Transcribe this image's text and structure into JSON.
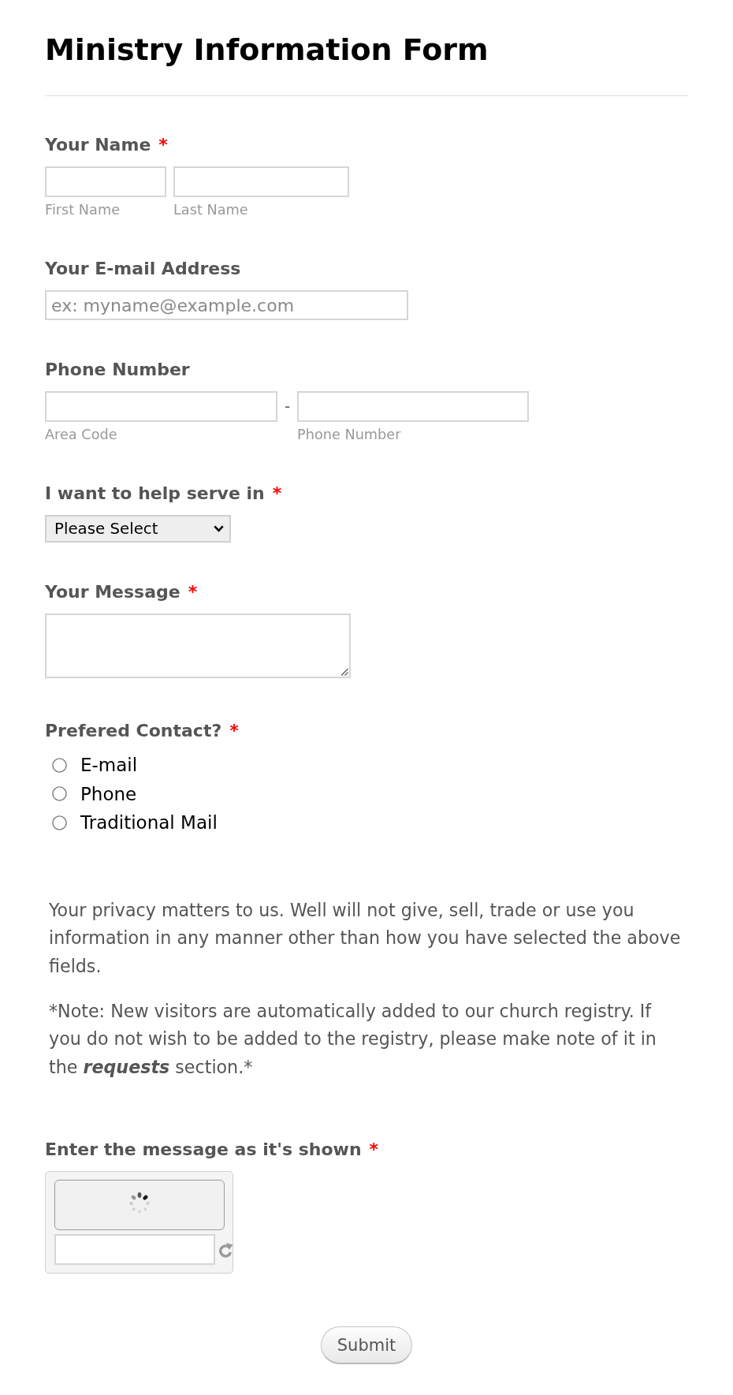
{
  "title": "Ministry Information Form",
  "fields": [
    {
      "kind": "name",
      "label": "Your Name",
      "required_mark": "*",
      "inputs": [
        {
          "sublabel": "First Name"
        },
        {
          "sublabel": "Last Name"
        }
      ]
    },
    {
      "kind": "email",
      "label": "Your E-mail Address",
      "placeholder": "ex: myname@example.com"
    },
    {
      "kind": "phone",
      "label": "Phone Number",
      "separator": "-",
      "inputs": [
        {
          "sublabel": "Area Code"
        },
        {
          "sublabel": "Phone Number"
        }
      ]
    },
    {
      "kind": "dropdown",
      "label": "I want to help serve in",
      "required_mark": "*",
      "value": "Please Select"
    },
    {
      "kind": "textarea",
      "label": "Your Message",
      "required_mark": "*"
    },
    {
      "kind": "radio",
      "label": "Prefered Contact?",
      "required_mark": "*",
      "options": [
        {
          "label": "E-mail",
          "selected": false
        },
        {
          "label": "Phone",
          "selected": false
        },
        {
          "label": "Traditional Mail",
          "selected": false
        }
      ]
    },
    {
      "kind": "text",
      "paragraphs": [
        {
          "runs": [
            {
              "text": "Your privacy matters to us. Well will not give, sell, trade or use you information in any manner other than how you have selected the above fields.",
              "emphasis": false
            }
          ]
        },
        {
          "runs": [
            {
              "text": "*Note: New visitors are automatically added to our church registry. If you do not wish to be added to the registry, please make note of it in the ",
              "emphasis": false
            },
            {
              "text": "requests",
              "emphasis": true
            },
            {
              "text": " section.*",
              "emphasis": false
            }
          ]
        }
      ]
    },
    {
      "kind": "captcha",
      "label": "Enter the message as it's shown",
      "required_mark": "*"
    }
  ],
  "submit": {
    "label": "Submit"
  }
}
